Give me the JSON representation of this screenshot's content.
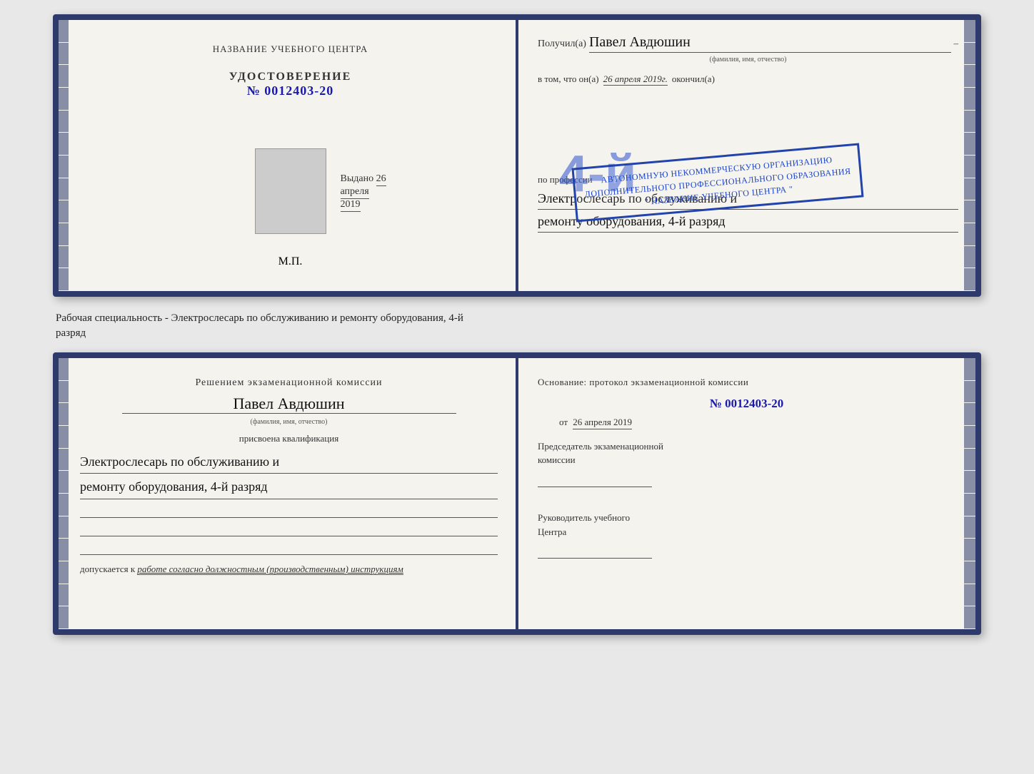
{
  "top_doc": {
    "left": {
      "center_title": "НАЗВАНИЕ УЧЕБНОГО ЦЕНТРА",
      "udostoverenie_label": "УДОСТОВЕРЕНИЕ",
      "udostoverenie_number": "№ 0012403-20",
      "vydano_label": "Выдано",
      "vydano_date": "26 апреля 2019",
      "mp_label": "М.П."
    },
    "right": {
      "poluchil_label": "Получил(a)",
      "name_handwritten": "Павел Авдюшин",
      "fio_hint": "(фамилия, имя, отчество)",
      "vtom_label": "в том, что он(а)",
      "date_value": "26 апреля 2019г.",
      "okonchil_label": "окончил(а)",
      "big_number": "4-й",
      "stamp_line1": "АВТОНОМНУЮ НЕКОММЕРЧЕСКУЮ ОРГАНИЗАЦИЮ",
      "stamp_line2": "ДОПОЛНИТЕЛЬНОГО ПРОФЕССИОНАЛЬНОГО ОБРАЗОВАНИЯ",
      "stamp_line3": "\" НАЗВАНИЕ УЧЕБНОГО ЦЕНТРА \"",
      "po_professii_label": "по профессии",
      "profession_line1": "Электрослесарь по обслуживанию и",
      "profession_line2": "ремонту оборудования, 4-й разряд"
    }
  },
  "separator": {
    "text_line1": "Рабочая специальность - Электрослесарь по обслуживанию и ремонту оборудования, 4-й",
    "text_line2": "разряд"
  },
  "bottom_doc": {
    "left": {
      "resheniem_label": "Решением экзаменационной комиссии",
      "name_handwritten": "Павел Авдюшин",
      "fio_hint": "(фамилия, имя, отчество)",
      "prisvoena_label": "присвоена квалификация",
      "qualification_line1": "Электрослесарь по обслуживанию и",
      "qualification_line2": "ремонту оборудования, 4-й разряд",
      "dopuskaetsya_label": "допускается к",
      "dopusk_text": "работе согласно должностным (производственным) инструкциям"
    },
    "right": {
      "osnovanie_label": "Основание: протокол экзаменационной комиссии",
      "number_value": "№ 0012403-20",
      "ot_label": "от",
      "ot_date": "26 апреля 2019",
      "predsedatel_label": "Председатель экзаменационной",
      "komissii_label": "комиссии",
      "rukovoditel_label": "Руководитель учебного",
      "centra_label": "Центра"
    }
  }
}
